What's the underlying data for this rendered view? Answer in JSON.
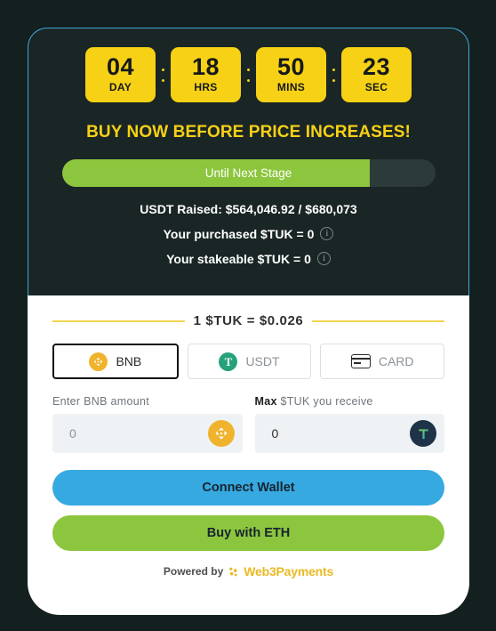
{
  "countdown": {
    "units": [
      {
        "value": "04",
        "label": "DAY"
      },
      {
        "value": "18",
        "label": "HRS"
      },
      {
        "value": "50",
        "label": "MINS"
      },
      {
        "value": "23",
        "label": "SEC"
      }
    ]
  },
  "headline": "BUY NOW BEFORE PRICE INCREASES!",
  "progress": {
    "label": "Until Next Stage",
    "percent": 82.6,
    "fill_color": "#8cc63e",
    "track_color": "#2c3a39"
  },
  "stats": {
    "raised": "USDT Raised: $564,046.92 / $680,073",
    "purchased": "Your purchased $TUK = 0",
    "stakeable": "Your stakeable $TUK = 0",
    "info_glyph": "i"
  },
  "rate": "1 $TUK = $0.026",
  "methods": [
    {
      "label": "BNB",
      "icon": "bnb-icon",
      "active": true
    },
    {
      "label": "USDT",
      "icon": "tether-icon",
      "active": false
    },
    {
      "label": "CARD",
      "icon": "credit-card-icon",
      "active": false
    }
  ],
  "inputs": {
    "pay_label": "Enter BNB amount",
    "max_label": "Max",
    "receive_label": "$TUK you receive",
    "pay_value": "0",
    "receive_value": "0"
  },
  "buttons": {
    "connect": "Connect Wallet",
    "buy": "Buy with ETH"
  },
  "footer": {
    "powered_by": "Powered by",
    "brand": "Web3Payments"
  },
  "colors": {
    "page_bg": "#141f1f",
    "card_dark": "#1a2525",
    "card_border": "#3fa9d8",
    "accent_yellow": "#f6d115",
    "accent_green": "#8cc63e",
    "accent_blue": "#36a9e0",
    "brand_gold": "#e8b923"
  }
}
